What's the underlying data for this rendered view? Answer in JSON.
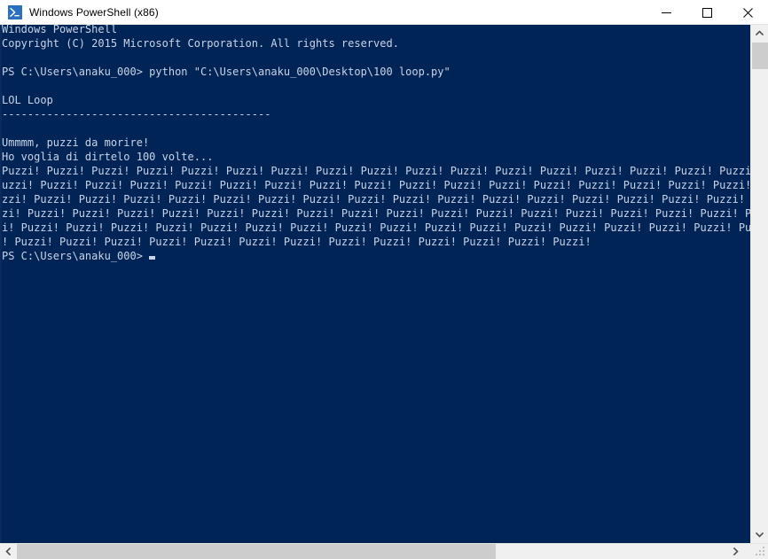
{
  "window": {
    "title": "Windows PowerShell (x86)",
    "icon": "powershell-icon",
    "colors": {
      "console_bg": "#012456",
      "console_fg": "#c8d4e8",
      "titlebar_bg": "#ffffff",
      "scrollbar_track": "#f0f0f0",
      "scrollbar_thumb": "#cdcdcd"
    },
    "caption_buttons": {
      "minimize": "—",
      "maximize": "□",
      "close": "✕"
    }
  },
  "console": {
    "lines": [
      "Windows PowerShell",
      "Copyright (C) 2015 Microsoft Corporation. All rights reserved.",
      "",
      "PS C:\\Users\\anaku_000> python \"C:\\Users\\anaku_000\\Desktop\\100 loop.py\"",
      "",
      "LOL Loop",
      "------------------------------------------",
      "",
      "Ummmm, puzzi da morire!",
      "Ho voglia di dirtelo 100 volte...",
      "Puzzi! Puzzi! Puzzi! Puzzi! Puzzi! Puzzi! Puzzi! Puzzi! Puzzi! Puzzi! Puzzi! Puzzi! Puzzi! Puzzi! Puzzi! Puzzi! Puzzi! P",
      "uzzi! Puzzi! Puzzi! Puzzi! Puzzi! Puzzi! Puzzi! Puzzi! Puzzi! Puzzi! Puzzi! Puzzi! Puzzi! Puzzi! Puzzi! Puzzi! Puzzi! Pu",
      "zzi! Puzzi! Puzzi! Puzzi! Puzzi! Puzzi! Puzzi! Puzzi! Puzzi! Puzzi! Puzzi! Puzzi! Puzzi! Puzzi! Puzzi! Puzzi! Puzzi! Puz",
      "zi! Puzzi! Puzzi! Puzzi! Puzzi! Puzzi! Puzzi! Puzzi! Puzzi! Puzzi! Puzzi! Puzzi! Puzzi! Puzzi! Puzzi! Puzzi! Puzzi! Puzz",
      "i! Puzzi! Puzzi! Puzzi! Puzzi! Puzzi! Puzzi! Puzzi! Puzzi! Puzzi! Puzzi! Puzzi! Puzzi! Puzzi! Puzzi! Puzzi! Puzzi! Puzzi",
      "! Puzzi! Puzzi! Puzzi! Puzzi! Puzzi! Puzzi! Puzzi! Puzzi! Puzzi! Puzzi! Puzzi! Puzzi! Puzzi!"
    ],
    "prompt": "PS C:\\Users\\anaku_000>",
    "cursor": "block-cursor"
  },
  "scrollbars": {
    "vertical": {
      "up_arrow": "∧",
      "down_arrow": "∨"
    },
    "horizontal": {
      "left_arrow": "‹",
      "right_arrow": "›"
    },
    "resize_grip": "resize-grip"
  }
}
